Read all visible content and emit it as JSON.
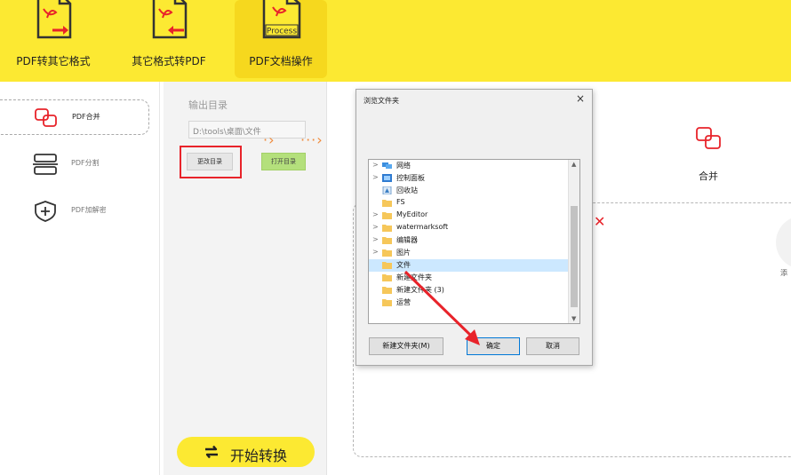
{
  "toolbar": {
    "items": [
      {
        "label": "PDF转其它格式"
      },
      {
        "label": "其它格式转PDF"
      },
      {
        "label": "PDF文档操作",
        "icon_text": "Process"
      }
    ]
  },
  "sidebar": {
    "items": [
      {
        "label": "PDF合并",
        "icon": "merge-icon",
        "selected": true
      },
      {
        "label": "PDF分割",
        "icon": "split-icon"
      },
      {
        "label": "PDF加解密",
        "icon": "encrypt-icon"
      }
    ]
  },
  "output": {
    "title": "输出目录",
    "path": "D:\\tools\\桌面\\文件",
    "change_button": "更改目录",
    "open_button": "打开目录"
  },
  "start_button": "开始转换",
  "main": {
    "merge_label": "合并",
    "add_label": "添"
  },
  "dialog": {
    "title": "浏览文件夹",
    "close": "×",
    "tree": [
      {
        "label": "网络",
        "expand": ">",
        "icon": "network-icon"
      },
      {
        "label": "控制面板",
        "expand": ">",
        "icon": "control-panel-icon"
      },
      {
        "label": "回收站",
        "expand": "",
        "icon": "recycle-bin-icon"
      },
      {
        "label": "FS",
        "expand": "",
        "icon": "folder-icon"
      },
      {
        "label": "MyEditor",
        "expand": ">",
        "icon": "folder-icon"
      },
      {
        "label": "watermarksoft",
        "expand": ">",
        "icon": "folder-icon"
      },
      {
        "label": "编辑器",
        "expand": ">",
        "icon": "folder-icon"
      },
      {
        "label": "图片",
        "expand": ">",
        "icon": "folder-icon"
      },
      {
        "label": "文件",
        "expand": "",
        "icon": "folder-icon",
        "selected": true
      },
      {
        "label": "新建文件夹",
        "expand": "",
        "icon": "folder-icon"
      },
      {
        "label": "新建文件夹 (3)",
        "expand": "",
        "icon": "folder-icon"
      },
      {
        "label": "运营",
        "expand": "",
        "icon": "folder-icon"
      }
    ],
    "new_folder_button": "新建文件夹(M)",
    "ok_button": "确定",
    "cancel_button": "取消"
  },
  "colors": {
    "brand_yellow": "#fce932",
    "highlight_red": "#e8232a",
    "open_green": "#b4e07c",
    "flow_orange": "#f08a3a"
  }
}
